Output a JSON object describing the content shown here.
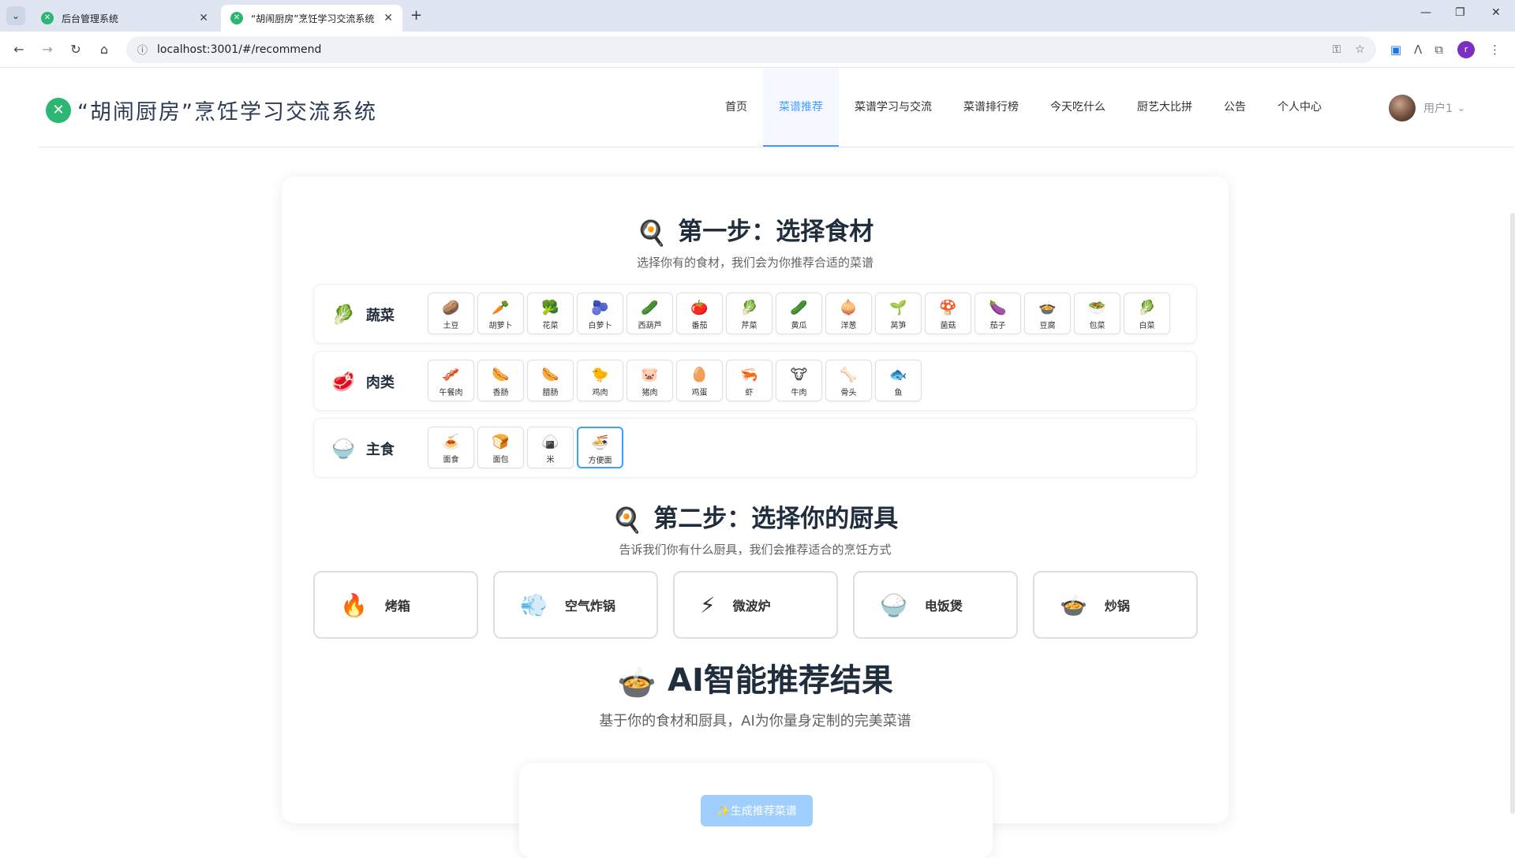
{
  "browser": {
    "tabs": [
      {
        "title": "后台管理系统",
        "active": false
      },
      {
        "title": "“胡闹厨房”烹饪学习交流系统",
        "active": true
      }
    ],
    "url": "localhost:3001/#/recommend",
    "profile_initial": "r"
  },
  "header": {
    "logo_text": "“胡闹厨房”烹饪学习交流系统",
    "nav": [
      "首页",
      "菜谱推荐",
      "菜谱学习与交流",
      "菜谱排行榜",
      "今天吃什么",
      "厨艺大比拼",
      "公告",
      "个人中心"
    ],
    "active_nav": "菜谱推荐",
    "user_name": "用户1"
  },
  "step1": {
    "icon": "🍳",
    "title": "第一步：选择食材",
    "subtitle": "选择你有的食材，我们会为你推荐合适的菜谱",
    "categories": [
      {
        "icon": "🥬",
        "name": "蔬菜",
        "items": [
          {
            "icon": "🥔",
            "name": "土豆"
          },
          {
            "icon": "🥕",
            "name": "胡萝卜"
          },
          {
            "icon": "🥦",
            "name": "花菜"
          },
          {
            "icon": "🫐",
            "name": "白萝卜"
          },
          {
            "icon": "🥒",
            "name": "西葫芦"
          },
          {
            "icon": "🍅",
            "name": "番茄"
          },
          {
            "icon": "🥬",
            "name": "芹菜"
          },
          {
            "icon": "🥒",
            "name": "黄瓜"
          },
          {
            "icon": "🧅",
            "name": "洋葱"
          },
          {
            "icon": "🌱",
            "name": "莴笋"
          },
          {
            "icon": "🍄",
            "name": "菌菇"
          },
          {
            "icon": "🍆",
            "name": "茄子"
          },
          {
            "icon": "🍲",
            "name": "豆腐"
          },
          {
            "icon": "🥗",
            "name": "包菜"
          },
          {
            "icon": "🥬",
            "name": "白菜"
          }
        ]
      },
      {
        "icon": "🥩",
        "name": "肉类",
        "items": [
          {
            "icon": "🥓",
            "name": "午餐肉"
          },
          {
            "icon": "🌭",
            "name": "香肠"
          },
          {
            "icon": "🌭",
            "name": "腊肠"
          },
          {
            "icon": "🐤",
            "name": "鸡肉"
          },
          {
            "icon": "🐷",
            "name": "猪肉"
          },
          {
            "icon": "🥚",
            "name": "鸡蛋"
          },
          {
            "icon": "🦐",
            "name": "虾"
          },
          {
            "icon": "🐮",
            "name": "牛肉"
          },
          {
            "icon": "🦴",
            "name": "骨头"
          },
          {
            "icon": "🐟",
            "name": "鱼"
          }
        ]
      },
      {
        "icon": "🍚",
        "name": "主食",
        "items": [
          {
            "icon": "🍝",
            "name": "面食"
          },
          {
            "icon": "🍞",
            "name": "面包"
          },
          {
            "icon": "🍙",
            "name": "米"
          },
          {
            "icon": "🍜",
            "name": "方便面"
          }
        ]
      }
    ],
    "selected_item": "方便面"
  },
  "step2": {
    "icon": "🍳",
    "title": "第二步：选择你的厨具",
    "subtitle": "告诉我们你有什么厨具，我们会推荐适合的烹饪方式",
    "tools": [
      {
        "icon": "🔥",
        "name": "烤箱"
      },
      {
        "icon": "💨",
        "name": "空气炸锅"
      },
      {
        "icon": "⚡",
        "name": "微波炉"
      },
      {
        "icon": "🍚",
        "name": "电饭煲"
      },
      {
        "icon": "🍲",
        "name": "炒锅"
      }
    ]
  },
  "result": {
    "icon": "🍲",
    "title": "AI智能推荐结果",
    "subtitle": "基于你的食材和厨具，AI为你量身定制的完美菜谱",
    "button_label": "✨生成推荐菜谱"
  },
  "colors": {
    "accent": "#409eff",
    "brand_green": "#2bb673",
    "title_dark": "#1f2d3d"
  }
}
